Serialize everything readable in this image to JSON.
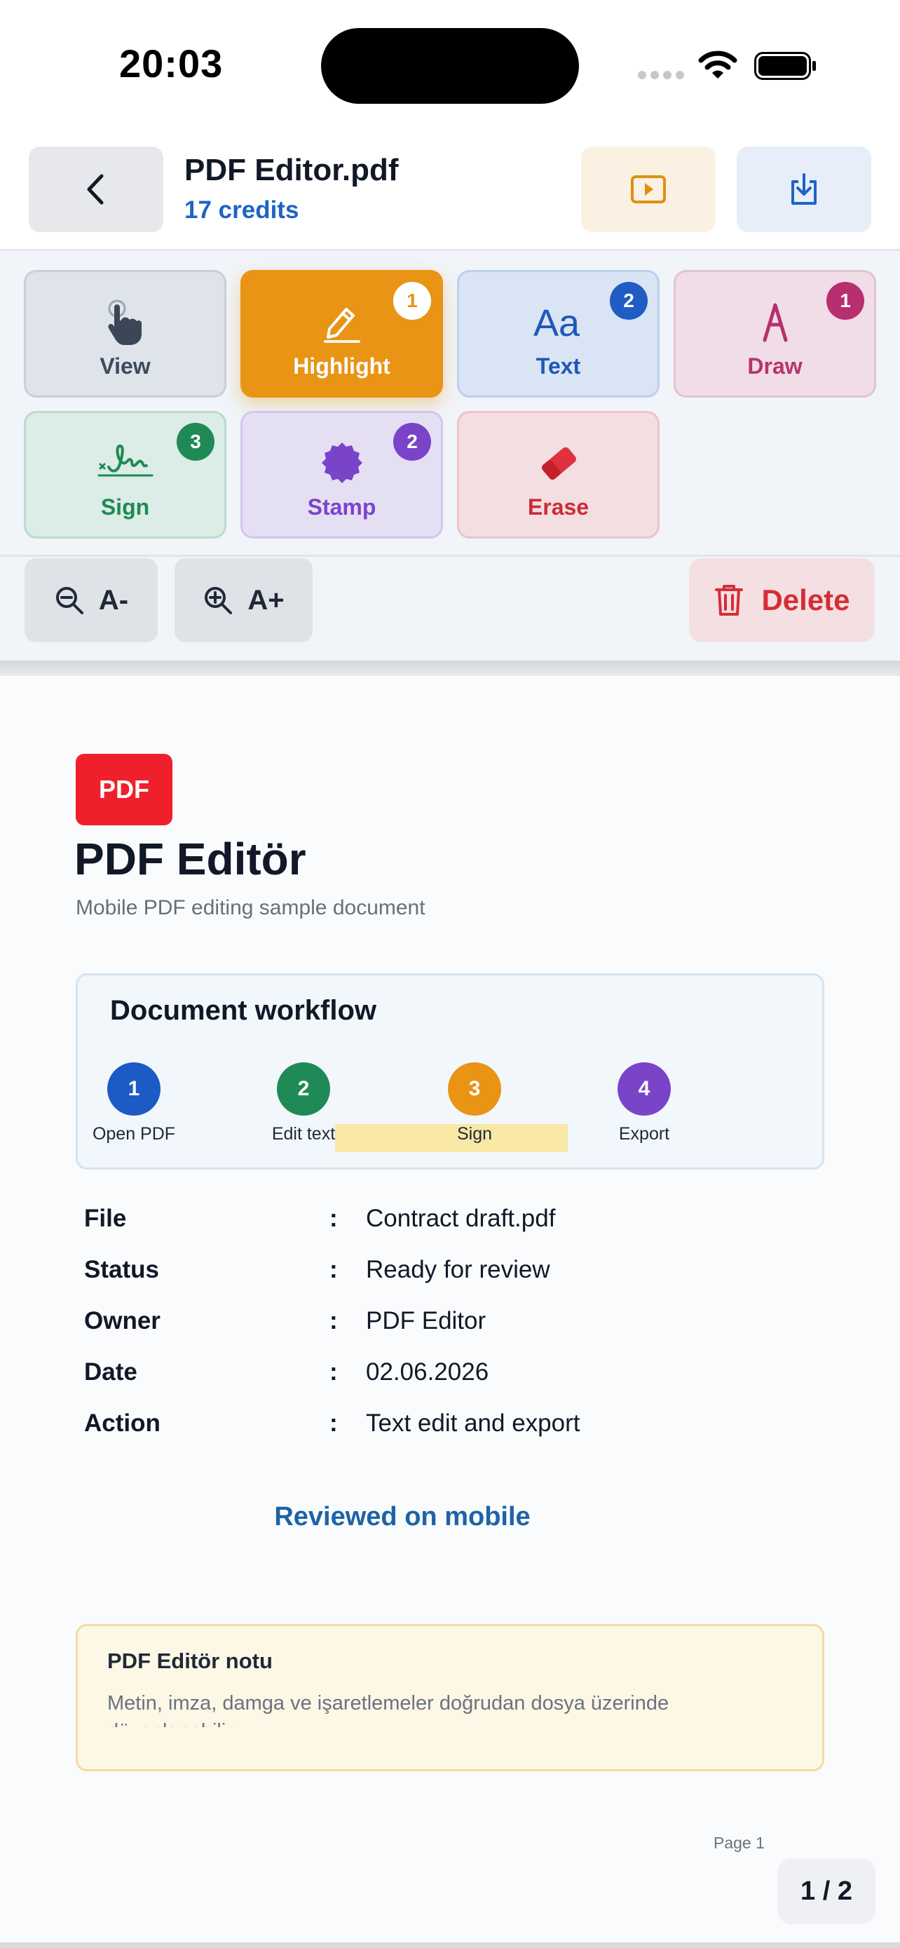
{
  "status_bar": {
    "time": "20:03"
  },
  "header": {
    "file_name": "PDF Editor.pdf",
    "credits": "17 credits"
  },
  "tools": [
    {
      "label": "View",
      "badge": ""
    },
    {
      "label": "Highlight",
      "badge": "1"
    },
    {
      "label": "Text",
      "badge": "2"
    },
    {
      "label": "Draw",
      "badge": "1"
    },
    {
      "label": "Sign",
      "badge": "3"
    },
    {
      "label": "Stamp",
      "badge": "2"
    },
    {
      "label": "Erase",
      "badge": ""
    }
  ],
  "zoom": {
    "zoom_out_label": "A-",
    "zoom_in_label": "A+"
  },
  "delete_label": "Delete",
  "document": {
    "badge": "PDF",
    "title": "PDF Editör",
    "subtitle": "Mobile PDF editing sample document",
    "workflow": {
      "title": "Document workflow",
      "steps": [
        {
          "number": "1",
          "label": "Open PDF",
          "color": "#1d5bc4"
        },
        {
          "number": "2",
          "label": "Edit text",
          "color": "#1f8a55"
        },
        {
          "number": "3",
          "label": "Sign",
          "color": "#e99415"
        },
        {
          "number": "4",
          "label": "Export",
          "color": "#7a44c9"
        }
      ]
    },
    "info": [
      {
        "key": "File",
        "colon": ":",
        "value": "Contract draft.pdf"
      },
      {
        "key": "Status",
        "colon": ":",
        "value": "Ready for review"
      },
      {
        "key": "Owner",
        "colon": ":",
        "value": "PDF Editor"
      },
      {
        "key": "Date",
        "colon": ":",
        "value": "02.06.2026"
      },
      {
        "key": "Action",
        "colon": ":",
        "value": "Text edit and export"
      }
    ],
    "reviewed": "Reviewed on mobile",
    "note": {
      "title": "PDF Editör notu",
      "body": "Metin, imza, damga ve işaretlemeler doğrudan dosya üzerinde düzenlenebilir."
    },
    "page_label": "Page 1"
  },
  "page_counter": "1 / 2"
}
